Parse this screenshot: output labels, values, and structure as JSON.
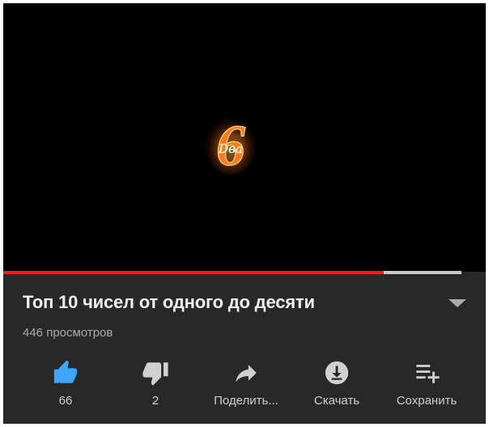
{
  "video": {
    "overlay_text": "Dва",
    "overlay_digit": "6",
    "progress": 0.83
  },
  "info": {
    "title": "Топ 10 чисел от одного до десяти",
    "views": "446 просмотров"
  },
  "actions": {
    "like": {
      "label": "66",
      "icon": "thumbs-up-icon",
      "active_color": "#3ea6ff"
    },
    "dislike": {
      "label": "2",
      "icon": "thumbs-down-icon"
    },
    "share": {
      "label": "Поделить...",
      "icon": "share-icon"
    },
    "download": {
      "label": "Скачать",
      "icon": "download-icon"
    },
    "save": {
      "label": "Сохранить",
      "icon": "playlist-add-icon"
    }
  },
  "colors": {
    "panel": "#282828",
    "progress": "#e0261c",
    "accent": "#3ea6ff"
  }
}
